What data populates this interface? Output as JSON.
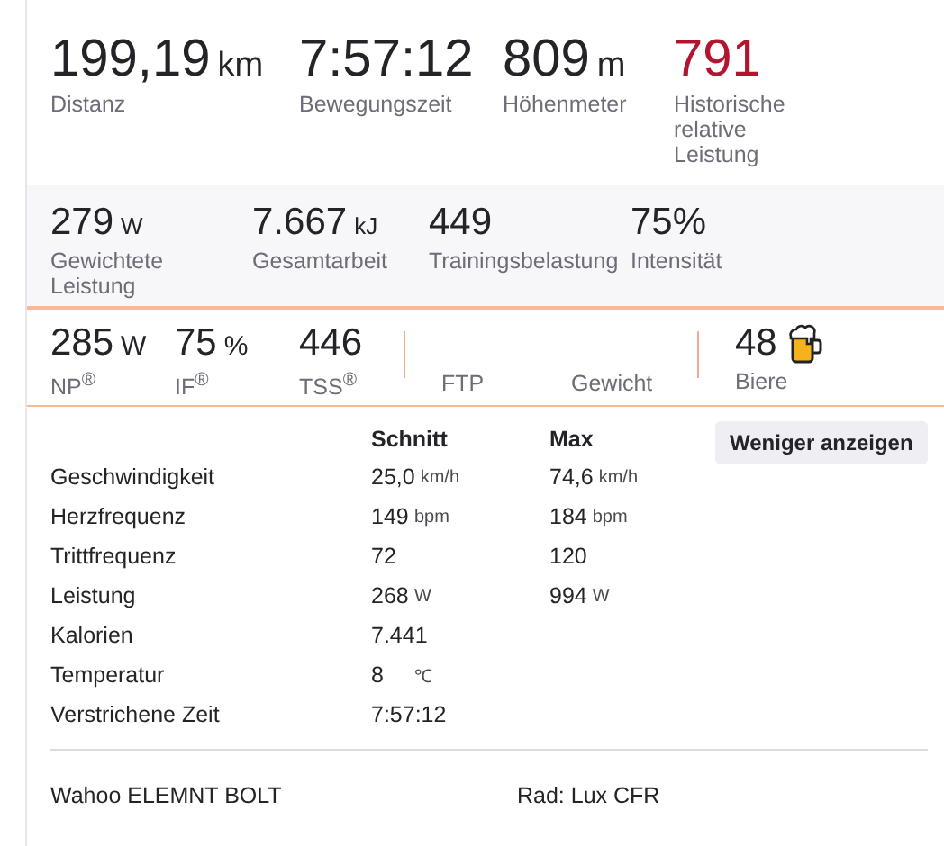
{
  "summary": [
    {
      "value": "199,19",
      "unit": "km",
      "label": "Distanz"
    },
    {
      "value": "7:57:12",
      "label": "Bewegungszeit"
    },
    {
      "value": "809",
      "unit": "m",
      "label": "Höhenmeter"
    },
    {
      "value": "791",
      "label": "Historische relative Leistung",
      "color": "#b3142e"
    }
  ],
  "power": [
    {
      "value": "279",
      "unit": "W",
      "label": "Gewichtete Leistung"
    },
    {
      "value": "7.667",
      "unit": "kJ",
      "label": "Gesamtarbeit"
    },
    {
      "value": "449",
      "label": "Trainingsbelastung"
    },
    {
      "value": "75%",
      "label": "Intensität"
    }
  ],
  "extras": [
    [
      {
        "value": "285",
        "unit": "W",
        "label": "NP$^{®}$"
      },
      {
        "value": "75",
        "unit": "%",
        "label": "IF$^{®}$"
      },
      {
        "value": "446",
        "label": "TSS$^{®}$"
      }
    ],
    [
      {
        "label": "FTP"
      },
      {
        "label": "Gewicht"
      }
    ],
    [
      {
        "value": "48",
        "label": "Biere",
        "kind": "beer"
      }
    ]
  ],
  "details": {
    "columns": [
      "Schnitt",
      "Max"
    ],
    "toggle_button": "Weniger anzeigen",
    "rows": [
      {
        "label": "Geschwindigkeit",
        "avg": "25,0",
        "avg_unit": "km/h",
        "max": "74,6",
        "max_unit": "km/h"
      },
      {
        "label": "Herzfrequenz",
        "avg": "149",
        "avg_unit": "bpm",
        "max": "184",
        "max_unit": "bpm"
      },
      {
        "label": "Trittfrequenz",
        "avg": "72",
        "max": "120"
      },
      {
        "label": "Leistung",
        "avg": "268",
        "avg_unit": "W",
        "max": "994",
        "max_unit": "W"
      },
      {
        "label": "Kalorien",
        "avg": "7.441"
      },
      {
        "label": "Temperatur",
        "avg": "8",
        "avg_unit": "℃"
      },
      {
        "label": "Verstrichene Zeit",
        "avg": "7:57:12"
      }
    ]
  },
  "footer": {
    "device": "Wahoo ELEMNT BOLT",
    "bike": "Rad: Lux CFR"
  }
}
